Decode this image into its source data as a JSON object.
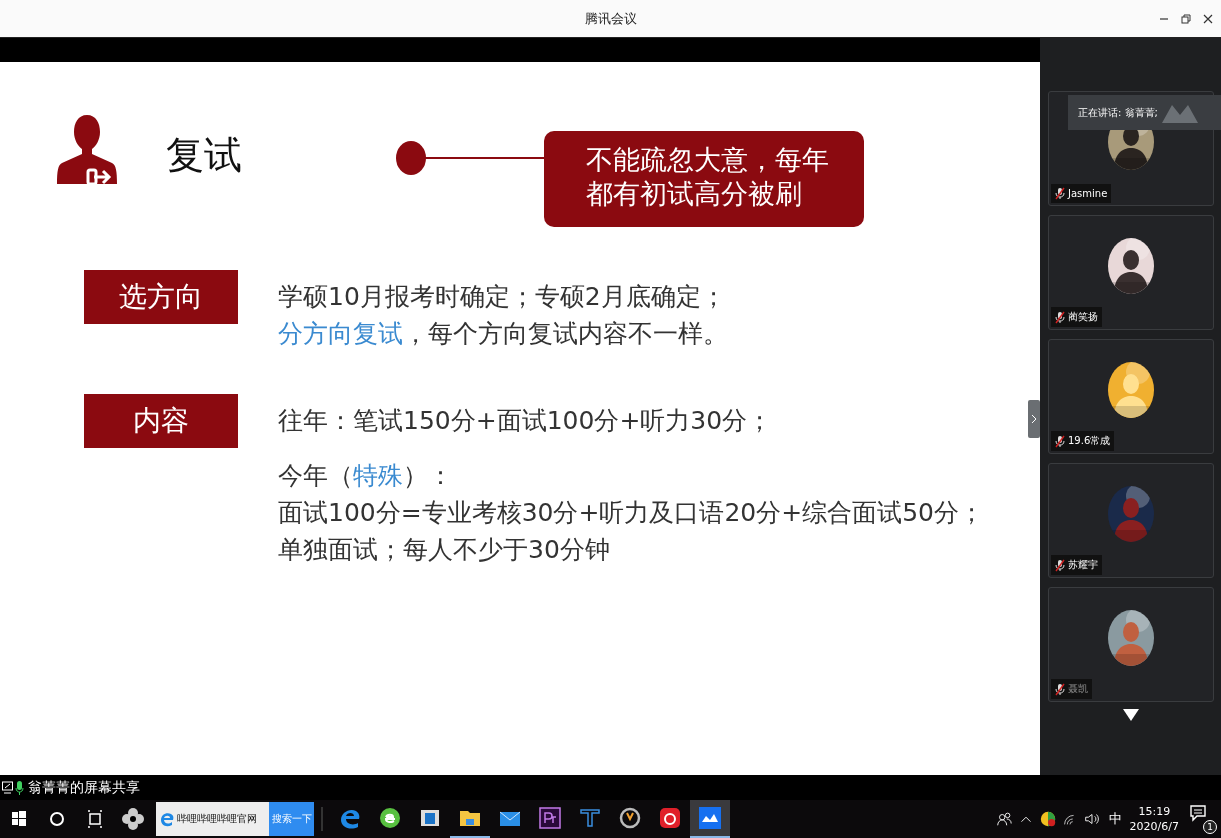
{
  "window": {
    "title": "腾讯会议"
  },
  "slide": {
    "title": "复试",
    "callout": [
      "不能疏忽大意，每年",
      "都有初试高分被刷"
    ],
    "sections": [
      {
        "label": "选方向",
        "groups": [
          [
            [
              {
                "text": "学硕10月报考时确定；专硕2月底确定；",
                "accent": false
              }
            ],
            [
              {
                "text": "分方向复试",
                "accent": true
              },
              {
                "text": "，每个方向复试内容不一样。",
                "accent": false
              }
            ]
          ]
        ]
      },
      {
        "label": "内容",
        "groups": [
          [
            [
              {
                "text": "往年：笔试150分+面试100分+听力30分；",
                "accent": false
              }
            ]
          ],
          [
            [
              {
                "text": "今年（",
                "accent": false
              },
              {
                "text": "特殊",
                "accent": true
              },
              {
                "text": "）：",
                "accent": false
              }
            ],
            [
              {
                "text": "面试100分=专业考核30分+听力及口语20分+综合面试50分；",
                "accent": false
              }
            ],
            [
              {
                "text": "单独面试；每人不少于30分钟",
                "accent": false
              }
            ]
          ]
        ]
      }
    ]
  },
  "speaking": "正在讲话: 翁菁菁;",
  "participants": [
    {
      "name": "Jasmine",
      "muted": true,
      "dimmed": false
    },
    {
      "name": "蔺笑扬",
      "muted": true,
      "dimmed": false
    },
    {
      "name": "19.6常成",
      "muted": true,
      "dimmed": false
    },
    {
      "name": "苏耀宇",
      "muted": true,
      "dimmed": false
    },
    {
      "name": "聂凯",
      "muted": true,
      "dimmed": true
    }
  ],
  "share_label": "翁菁菁的屏幕共享",
  "taskbar": {
    "search": {
      "value": "哔哩哔哩哔哩官网"
    },
    "search_button": "搜索一下",
    "apps": [
      {
        "kind": "edge",
        "selected": false,
        "running": false
      },
      {
        "kind": "ie",
        "selected": false,
        "running": false
      },
      {
        "kind": "reader",
        "selected": false,
        "running": false
      },
      {
        "kind": "folder",
        "selected": false,
        "running": true
      },
      {
        "kind": "mail",
        "selected": false,
        "running": false
      },
      {
        "kind": "premiere",
        "selected": false,
        "running": false
      },
      {
        "kind": "tool",
        "selected": false,
        "running": false
      },
      {
        "kind": "game",
        "selected": false,
        "running": false
      },
      {
        "kind": "music",
        "selected": false,
        "running": false
      },
      {
        "kind": "meeting",
        "selected": true,
        "running": true
      }
    ],
    "ime": "中",
    "time": "15:19",
    "date": "2020/6/7",
    "notifications": "1"
  }
}
